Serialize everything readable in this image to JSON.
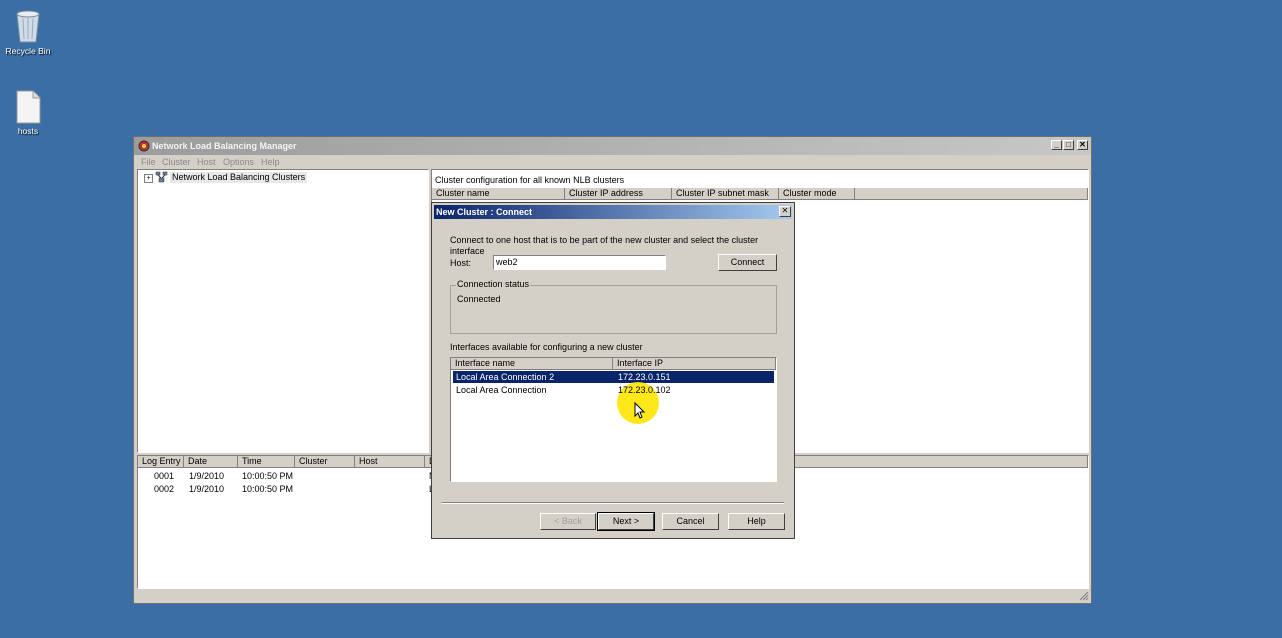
{
  "desktop": {
    "icons": [
      {
        "label": "Recycle Bin"
      },
      {
        "label": "hosts"
      }
    ]
  },
  "window": {
    "title": "Network Load Balancing Manager",
    "menu": [
      "File",
      "Cluster",
      "Host",
      "Options",
      "Help"
    ],
    "tree": {
      "root": "Network Load Balancing Clusters"
    },
    "cluster_panel": {
      "caption": "Cluster configuration for all known NLB clusters",
      "columns": [
        "Cluster name",
        "Cluster IP address",
        "Cluster IP subnet mask",
        "Cluster mode"
      ]
    },
    "log": {
      "columns": [
        "Log Entry",
        "Date",
        "Time",
        "Cluster",
        "Host",
        "D"
      ],
      "rows": [
        {
          "entry": "0001",
          "date": "1/9/2010",
          "time": "10:00:50 PM",
          "desc": "N"
        },
        {
          "entry": "0002",
          "date": "1/9/2010",
          "time": "10:00:50 PM",
          "desc": "L"
        }
      ]
    }
  },
  "dialog": {
    "title": "New Cluster : Connect",
    "instruction": "Connect to one host that is to be part of the new cluster and select the cluster interface",
    "host_label": "Host:",
    "host_value": "web2",
    "connect_label": "Connect",
    "status_group_label": "Connection status",
    "status_text": "Connected",
    "interfaces_caption": "Interfaces available for configuring a new cluster",
    "interfaces_columns": [
      "Interface name",
      "Interface IP"
    ],
    "interfaces": [
      {
        "name": "Local Area Connection 2",
        "ip": "172.23.0.151",
        "selected": true
      },
      {
        "name": "Local Area Connection",
        "ip": "172.23.0.102",
        "selected": false
      }
    ],
    "buttons": {
      "back": "< Back",
      "next": "Next >",
      "cancel": "Cancel",
      "help": "Help"
    }
  },
  "colors": {
    "desktop": "#3a6ea5",
    "dialog_title": "#0a246a",
    "selection": "#0a246a",
    "cursor_highlight": "#ffe600"
  }
}
